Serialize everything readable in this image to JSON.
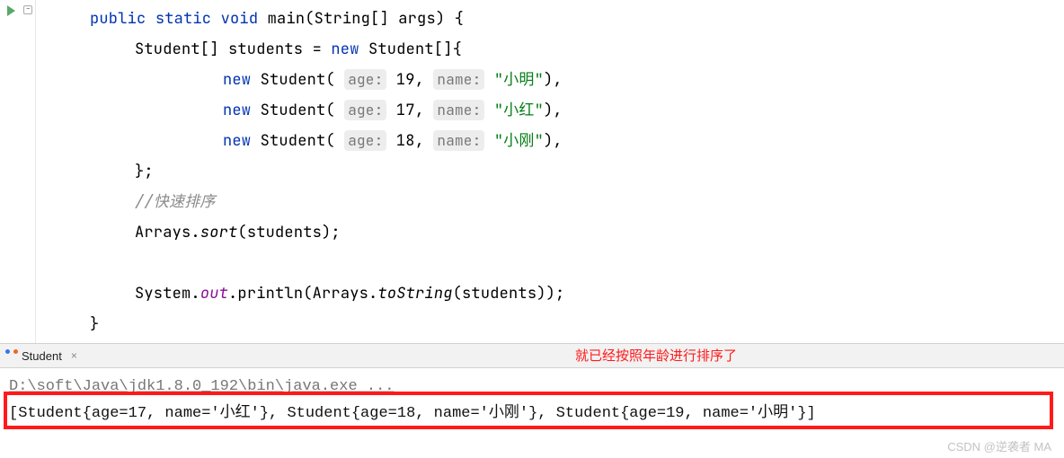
{
  "code": {
    "sig_kw1": "public",
    "sig_kw2": "static",
    "sig_kw3": "void",
    "sig_name": "main",
    "sig_params_prefix": "(String[] args) {",
    "decl_prefix": "Student[] students = ",
    "decl_new": "new",
    "decl_suffix": " Student[]{",
    "new_kw": "new",
    "ctor1_open": " Student( ",
    "hint_age": "age:",
    "age1": " 19, ",
    "hint_name": "name:",
    "name1_open": " ",
    "name1": "\"小明\"",
    "ctor_close": "),",
    "age2": " 17, ",
    "name2": "\"小红\"",
    "age3": " 18, ",
    "name3": "\"小刚\"",
    "brace_close": "};",
    "comment": "//快速排序",
    "sort_class": "Arrays.",
    "sort_method": "sort",
    "sort_args": "(students);",
    "print_class": "System.",
    "print_out": "out",
    "print_dot": ".println(Arrays.",
    "tostring": "toString",
    "print_args": "(students));",
    "method_close": "}"
  },
  "tab": {
    "label": "Student",
    "close": "×",
    "annotation": "就已经按照年龄进行排序了"
  },
  "console": {
    "path": "D:\\soft\\Java\\jdk1.8.0_192\\bin\\java.exe ...",
    "output": "[Student{age=17, name='小红'}, Student{age=18, name='小刚'}, Student{age=19, name='小明'}]"
  },
  "watermark": "CSDN @逆袭者 MA"
}
